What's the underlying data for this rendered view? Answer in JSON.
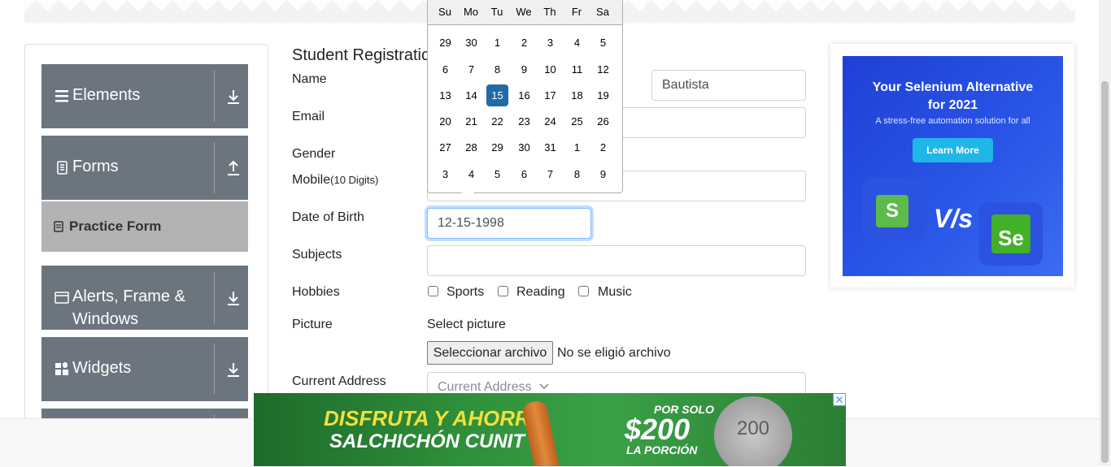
{
  "sidebar": {
    "groups": [
      {
        "label": "Elements",
        "icon": "hamburger-icon",
        "arrow": "download-icon"
      },
      {
        "label": "Forms",
        "icon": "document-icon",
        "arrow": "upload-icon"
      },
      {
        "label": "Alerts, Frame & Windows",
        "icon": "window-icon",
        "arrow": "download-icon"
      },
      {
        "label": "Widgets",
        "icon": "widgets-icon",
        "arrow": "download-icon"
      }
    ],
    "active_item": "Practice Form"
  },
  "form": {
    "title": "Student Registration Form",
    "name_label": "Name",
    "last_name_value": "Bautista",
    "email_label": "Email",
    "gender_label": "Gender",
    "mobile_label": "Mobile",
    "mobile_hint": "(10 Digits)",
    "dob_label": "Date of Birth",
    "dob_value": "12-15-1998",
    "subjects_label": "Subjects",
    "hobbies_label": "Hobbies",
    "hobbies": [
      "Sports",
      "Reading",
      "Music"
    ],
    "picture_label": "Picture",
    "select_picture": "Select picture",
    "file_button": "Seleccionar archivo",
    "file_status": "No se eligió archivo",
    "address_label": "Current Address",
    "address_placeholder": "Current Address"
  },
  "calendar": {
    "day_names": [
      "Su",
      "Mo",
      "Tu",
      "We",
      "Th",
      "Fr",
      "Sa"
    ],
    "weeks": [
      [
        "29",
        "30",
        "1",
        "2",
        "3",
        "4",
        "5"
      ],
      [
        "6",
        "7",
        "8",
        "9",
        "10",
        "11",
        "12"
      ],
      [
        "13",
        "14",
        "15",
        "16",
        "17",
        "18",
        "19"
      ],
      [
        "20",
        "21",
        "22",
        "23",
        "24",
        "25",
        "26"
      ],
      [
        "27",
        "28",
        "29",
        "30",
        "31",
        "1",
        "2"
      ],
      [
        "3",
        "4",
        "5",
        "6",
        "7",
        "8",
        "9"
      ]
    ],
    "selected": "15"
  },
  "side_ad": {
    "headline1": "Your Selenium Alternative",
    "headline2": "for 2021",
    "subline": "A stress-free automation solution for all",
    "button": "Learn More",
    "vs": "V/s",
    "left_logo": "S",
    "right_logo": "Se"
  },
  "banner_ad": {
    "line1": "DISFRUTA Y AHORRA",
    "line2": "SALCHICHÓN CUNIT",
    "promo": "POR SOLO",
    "price": "$200",
    "unit": "LA PORCIÓN",
    "coin": "200"
  },
  "colors": {
    "sidebar_bg": "#6c757d",
    "selected_day": "#216ba5",
    "active_item_bg": "#b3b3b3"
  }
}
